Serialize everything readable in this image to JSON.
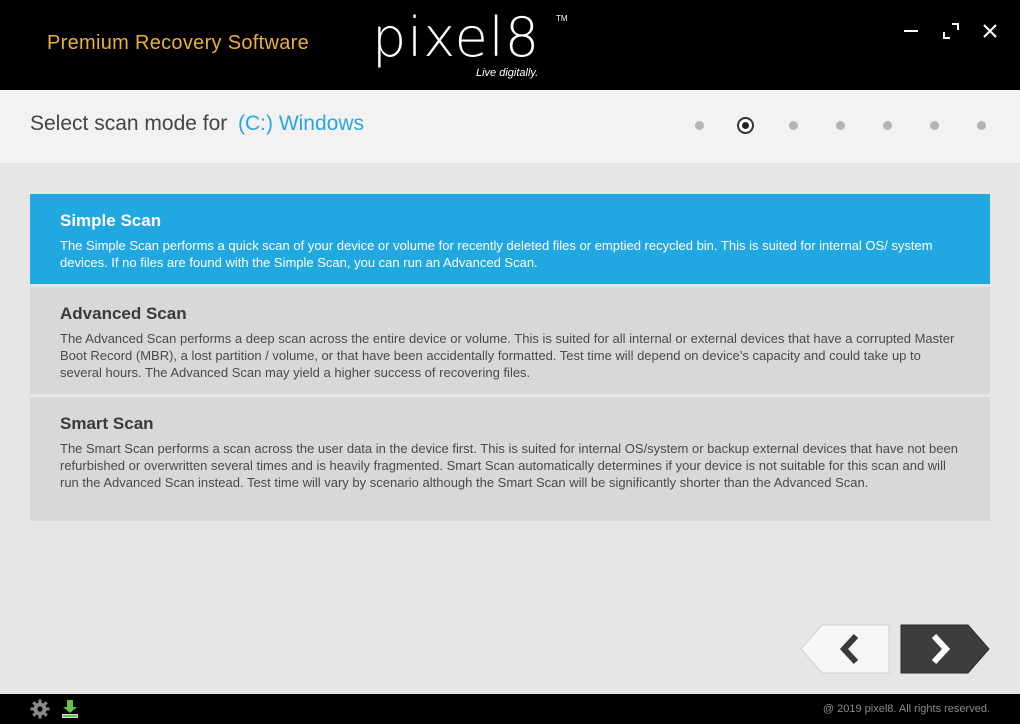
{
  "titlebar": {
    "tagline": "Premium Recovery Software",
    "logo_word": "pixel8",
    "logo_tm": "TM",
    "logo_sub": "Live digitally.",
    "icons": [
      "minimize-icon",
      "restore-icon",
      "close-icon"
    ]
  },
  "header": {
    "title": "Select scan mode for",
    "drive": "(C:) Windows",
    "steps_total": 7,
    "active_step": 2
  },
  "options": [
    {
      "title": "Simple Scan",
      "desc": "The Simple Scan performs a quick scan of your device or volume for recently deleted files or emptied recycled bin.  This is suited for internal OS/ system devices.  If no files are found with the Simple Scan, you can run an Advanced Scan.",
      "selected": true
    },
    {
      "title": "Advanced Scan",
      "desc": "The Advanced Scan performs a deep scan across the entire device or volume.  This is suited for all internal or external devices that have a corrupted Master Boot Record (MBR), a lost partition / volume, or that have been accidentally formatted.  Test time will depend on device’s capacity and could take up to several hours.  The Advanced Scan may yield a higher success of recovering files.",
      "selected": false
    },
    {
      "title": "Smart Scan",
      "desc": "The Smart Scan performs a scan across the user data in the device first.  This is suited for internal OS/system or backup external devices that have not been refurbished or overwritten several times and is heavily fragmented.  Smart Scan automatically determines if your device is not suitable for this scan and will run the Advanced Scan instead.  Test time will vary by scenario although the Smart Scan will be significantly shorter than the Advanced Scan.",
      "selected": false
    }
  ],
  "nav": {
    "back_icon": "chevron-left-icon",
    "next_icon": "chevron-right-icon"
  },
  "footer": {
    "copyright": "@ 2019 pixel8. All rights reserved.",
    "icons": [
      "gear-icon",
      "download-icon"
    ]
  },
  "colors": {
    "accent": "#21a8e1",
    "tagline": "#e8b23a"
  }
}
